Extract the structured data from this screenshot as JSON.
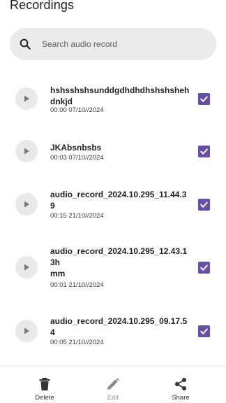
{
  "header": {
    "title": "Recordings"
  },
  "search": {
    "placeholder": "Search audio record",
    "icon": "search-icon"
  },
  "recordings": [
    {
      "name": "hshsshshsunddgdhdhdhshshsheh\ndnkjd",
      "meta": "00:00 07/10//2024",
      "checked": true
    },
    {
      "name": "JKAbsnbsbs",
      "meta": "00:03 07/10//2024",
      "checked": true
    },
    {
      "name": "audio_record_2024.10.295_11.44.3\n9",
      "meta": "00:15 21/10//2024",
      "checked": true
    },
    {
      "name": "audio_record_2024.10.295_12.43.1\n3h\nmm",
      "meta": "00:01 21/10//2024",
      "checked": true
    },
    {
      "name": "audio_record_2024.10.295_09.17.5\n4",
      "meta": "00:05 21/10//2024",
      "checked": true
    }
  ],
  "bottom_bar": {
    "delete_label": "Delete",
    "edit_label": "Edit",
    "share_label": "Share"
  },
  "colors": {
    "accent": "#6750a4",
    "search_bg": "#ebebeb",
    "play_bg": "#e9e9e9"
  }
}
